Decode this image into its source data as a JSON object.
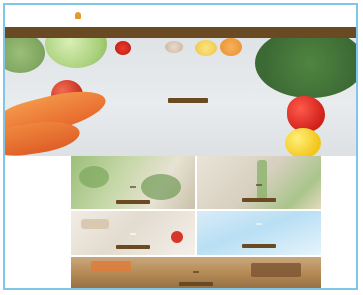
{
  "header": {
    "logo_text": "",
    "top_links": [
      "",
      "",
      "",
      "",
      ""
    ],
    "top_strong": ""
  },
  "navbar": {
    "items": [
      "",
      "",
      "",
      "",
      "",
      ""
    ]
  },
  "hero": {
    "title_line1": "",
    "title_line2": "",
    "button": ""
  },
  "tiles": [
    {
      "label": "",
      "button": ""
    },
    {
      "label": "",
      "button": ""
    },
    {
      "label": "",
      "button": ""
    },
    {
      "label": "",
      "button": ""
    },
    {
      "label": "",
      "button": ""
    }
  ],
  "colors": {
    "border": "#7fc6e8",
    "nav": "#6a4a22",
    "logo": "#e39b2e"
  }
}
